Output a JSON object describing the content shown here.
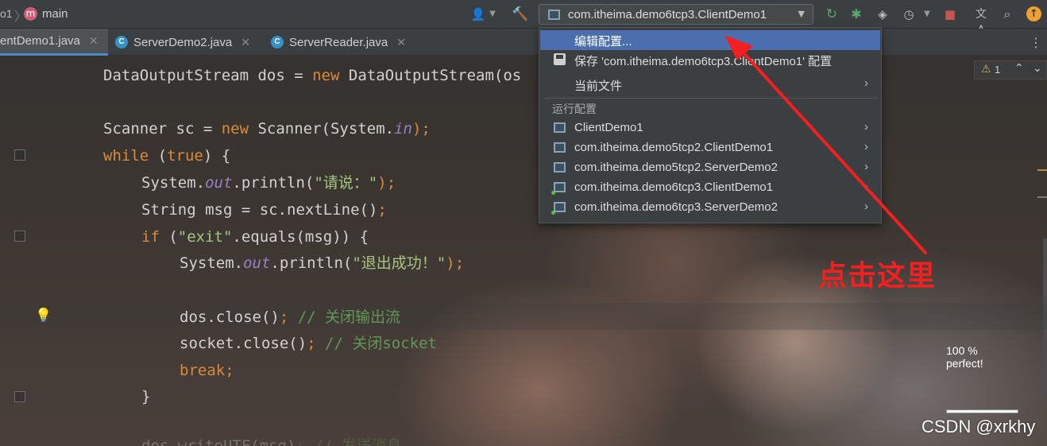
{
  "toolbar": {
    "project_fragment": "o1",
    "branch_badge": "m",
    "branch": "main",
    "run_config": "com.itheima.demo6tcp3.ClientDemo1",
    "translate_glyph": "文A"
  },
  "tabs": [
    {
      "label": "entDemo1.java",
      "active": true
    },
    {
      "label": "ServerDemo2.java",
      "active": false,
      "icon": "C"
    },
    {
      "label": "ServerReader.java",
      "active": false,
      "icon": "C"
    }
  ],
  "inspection": {
    "warnings": "1"
  },
  "code": {
    "l1": [
      "DataOutputStream dos = ",
      "new",
      " DataOutputStream(os"
    ],
    "l2a": "Scanner sc = ",
    "l2b": "new",
    "l2c": " Scanner(System.",
    "l2d": "in",
    "l2e": ");",
    "l3a": "while",
    "l3b": " (",
    "l3c": "true",
    "l3d": ") {",
    "l4a": "System.",
    "l4b": "out",
    "l4c": ".println(",
    "l4d": "\"请说：\"",
    "l4e": ");",
    "l5a": "String msg = sc.nextLine()",
    "l5b": ";",
    "l6a": "if",
    "l6b": " (",
    "l6c": "\"exit\"",
    "l6d": ".equals(msg)) {",
    "l7a": "System.",
    "l7b": "out",
    "l7c": ".println(",
    "l7d": "\"退出成功！\"",
    "l7e": ");",
    "l8a": "dos.close()",
    "l8b": ";",
    "l8c": " // 关闭输出流",
    "l9a": "socket.close()",
    "l9b": ";",
    "l9c": " // 关闭socket",
    "l10a": "break",
    "l10b": ";",
    "l11": "}",
    "l12a": "dos.writeUTF(msg)",
    "l12b": "; // 发送消息"
  },
  "menu": {
    "edit": "编辑配置...",
    "save": "保存 'com.itheima.demo6tcp3.ClientDemo1' 配置",
    "current_file": "当前文件",
    "section": "运行配置",
    "configs": [
      "ClientDemo1",
      "com.itheima.demo5tcp2.ClientDemo1",
      "com.itheima.demo5tcp2.ServerDemo2",
      "com.itheima.demo6tcp3.ClientDemo1",
      "com.itheima.demo6tcp3.ServerDemo2"
    ],
    "arrow": "›"
  },
  "annotation": {
    "text": "点击这里",
    "color": "#f22020"
  },
  "overlay": {
    "percent": "100 %",
    "status": "perfect!"
  },
  "watermark": "CSDN @xrkhy",
  "colors": {
    "keyword": "#d98a3c",
    "string": "#a7c57f",
    "comment": "#629755",
    "field": "#9b7fc4",
    "selection": "#4b6eaf"
  }
}
